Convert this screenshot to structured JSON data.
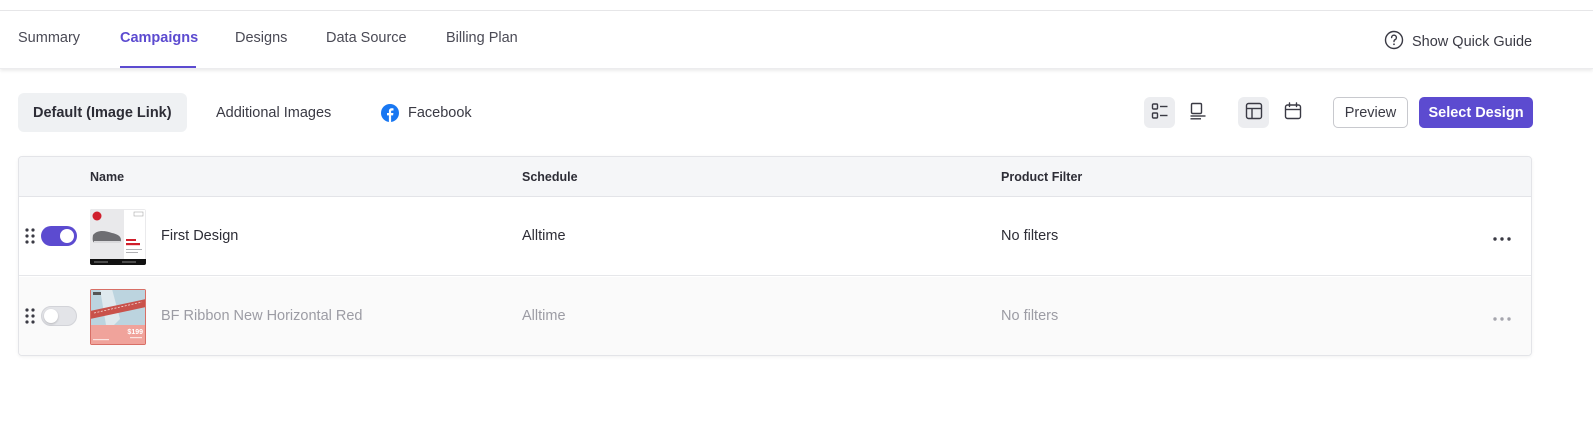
{
  "nav": {
    "tabs": [
      {
        "label": "Summary"
      },
      {
        "label": "Campaigns"
      },
      {
        "label": "Designs"
      },
      {
        "label": "Data Source"
      },
      {
        "label": "Billing Plan"
      }
    ],
    "active_tab": "Campaigns",
    "guide_label": "Show Quick Guide",
    "guide_icon": "question-circle-icon"
  },
  "subtabs": [
    {
      "label": "Default (Image Link)"
    },
    {
      "label": "Additional Images"
    },
    {
      "label": "Facebook",
      "icon": "facebook-icon"
    }
  ],
  "toolbar": {
    "view_icons": [
      "list-view-icon",
      "compact-view-icon",
      "table-view-icon",
      "calendar-icon"
    ],
    "preview_label": "Preview",
    "select_label": "Select Design"
  },
  "table": {
    "headers": {
      "name": "Name",
      "schedule": "Schedule",
      "filter": "Product Filter"
    },
    "rows": [
      {
        "enabled": true,
        "name": "First Design",
        "schedule": "Alltime",
        "filter": "No filters"
      },
      {
        "enabled": false,
        "name": "BF Ribbon New Horizontal Red",
        "schedule": "Alltime",
        "filter": "No filters",
        "price": "$199"
      }
    ]
  },
  "colors": {
    "accent": "#5c4bd0",
    "header_bg": "#f5f6f8",
    "muted_text": "#9c9ca4"
  }
}
